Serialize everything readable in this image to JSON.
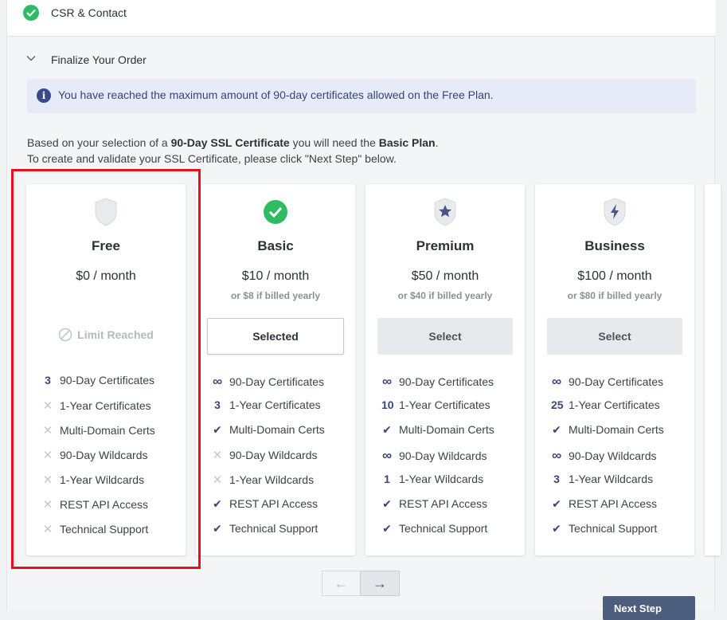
{
  "steps": {
    "completed_title": "CSR & Contact",
    "current_title": "Finalize Your Order"
  },
  "alert": {
    "message": "You have reached the maximum amount of 90-day certificates allowed on the Free Plan."
  },
  "intro": {
    "prefix": "Based on your selection of a ",
    "product": "90-Day SSL Certificate",
    "middle": " you will need the ",
    "plan": "Basic Plan",
    "suffix": ".",
    "line2": "To create and validate your SSL Certificate, please click \"Next Step\" below."
  },
  "plans": [
    {
      "name": "Free",
      "price": "$0 / month",
      "yearly": "",
      "status": "Limit Reached",
      "features": [
        {
          "mark": "3",
          "label": "90-Day Certificates"
        },
        {
          "mark": "✕",
          "label": "1-Year Certificates"
        },
        {
          "mark": "✕",
          "label": "Multi-Domain Certs"
        },
        {
          "mark": "✕",
          "label": "90-Day Wildcards"
        },
        {
          "mark": "✕",
          "label": "1-Year Wildcards"
        },
        {
          "mark": "✕",
          "label": "REST API Access"
        },
        {
          "mark": "✕",
          "label": "Technical Support"
        }
      ]
    },
    {
      "name": "Basic",
      "price": "$10 / month",
      "yearly": "or $8 if billed yearly",
      "button": "Selected",
      "features": [
        {
          "mark": "∞",
          "label": "90-Day Certificates"
        },
        {
          "mark": "3",
          "label": "1-Year Certificates"
        },
        {
          "mark": "✔",
          "label": "Multi-Domain Certs"
        },
        {
          "mark": "✕",
          "label": "90-Day Wildcards"
        },
        {
          "mark": "✕",
          "label": "1-Year Wildcards"
        },
        {
          "mark": "✔",
          "label": "REST API Access"
        },
        {
          "mark": "✔",
          "label": "Technical Support"
        }
      ]
    },
    {
      "name": "Premium",
      "price": "$50 / month",
      "yearly": "or $40 if billed yearly",
      "button": "Select",
      "features": [
        {
          "mark": "∞",
          "label": "90-Day Certificates"
        },
        {
          "mark": "10",
          "label": "1-Year Certificates"
        },
        {
          "mark": "✔",
          "label": "Multi-Domain Certs"
        },
        {
          "mark": "∞",
          "label": "90-Day Wildcards"
        },
        {
          "mark": "1",
          "label": "1-Year Wildcards"
        },
        {
          "mark": "✔",
          "label": "REST API Access"
        },
        {
          "mark": "✔",
          "label": "Technical Support"
        }
      ]
    },
    {
      "name": "Business",
      "price": "$100 / month",
      "yearly": "or $80 if billed yearly",
      "button": "Select",
      "features": [
        {
          "mark": "∞",
          "label": "90-Day Certificates"
        },
        {
          "mark": "25",
          "label": "1-Year Certificates"
        },
        {
          "mark": "✔",
          "label": "Multi-Domain Certs"
        },
        {
          "mark": "∞",
          "label": "90-Day Wildcards"
        },
        {
          "mark": "3",
          "label": "1-Year Wildcards"
        },
        {
          "mark": "✔",
          "label": "REST API Access"
        },
        {
          "mark": "✔",
          "label": "Technical Support"
        }
      ]
    }
  ],
  "pager": {
    "prev": "←",
    "next": "→"
  },
  "footer": {
    "next_step": "Next Step"
  },
  "colors": {
    "accent": "#3b4578",
    "success": "#2fbb62",
    "highlight": "#e8101c",
    "alert_bg": "#e7ebf8"
  },
  "icons": {
    "completed_step": "check-circle-icon",
    "current_step": "chevron-down-icon",
    "alert": "info-icon",
    "free_plan": "shield-icon",
    "basic_plan": "check-circle-icon",
    "premium_plan": "star-shield-icon",
    "business_plan": "bolt-shield-icon",
    "limit": "ban-icon"
  }
}
